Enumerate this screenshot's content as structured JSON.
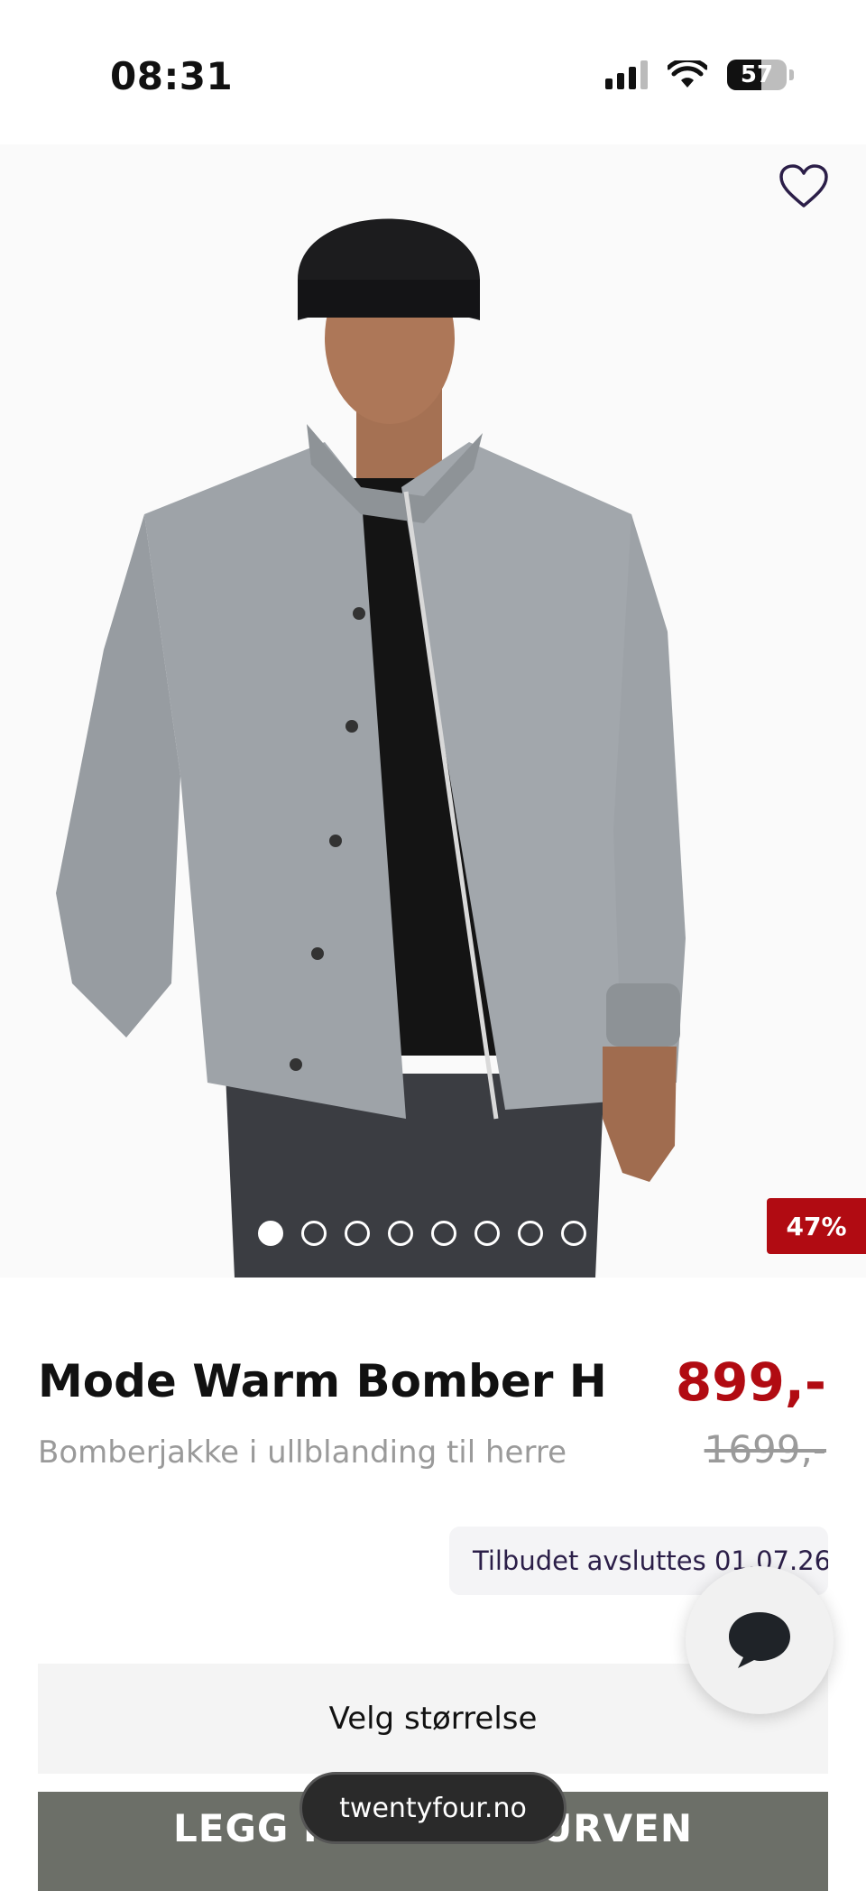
{
  "status_bar": {
    "time": "08:31",
    "battery": "57"
  },
  "product": {
    "name": "Mode Warm Bomber H",
    "subtitle": "Bomberjakke i ullblanding til herre",
    "price": "899,-",
    "original_price": "1699,-",
    "discount_badge": "47%",
    "offer_text": "Tilbudet avsluttes 01.07.26",
    "image_count": 8,
    "active_image_index": 0
  },
  "actions": {
    "size_select_label": "Velg størrelse",
    "add_to_cart_label": "LEGG I HANDLEKURVEN"
  },
  "browser": {
    "url": "twentyfour.no"
  },
  "icons": {
    "favorite": "heart-icon",
    "chat": "chat-bubble-icon"
  },
  "colors": {
    "sale_red": "#b10b12",
    "cart_button": "#6c6f68",
    "offer_text": "#2b1e48"
  }
}
